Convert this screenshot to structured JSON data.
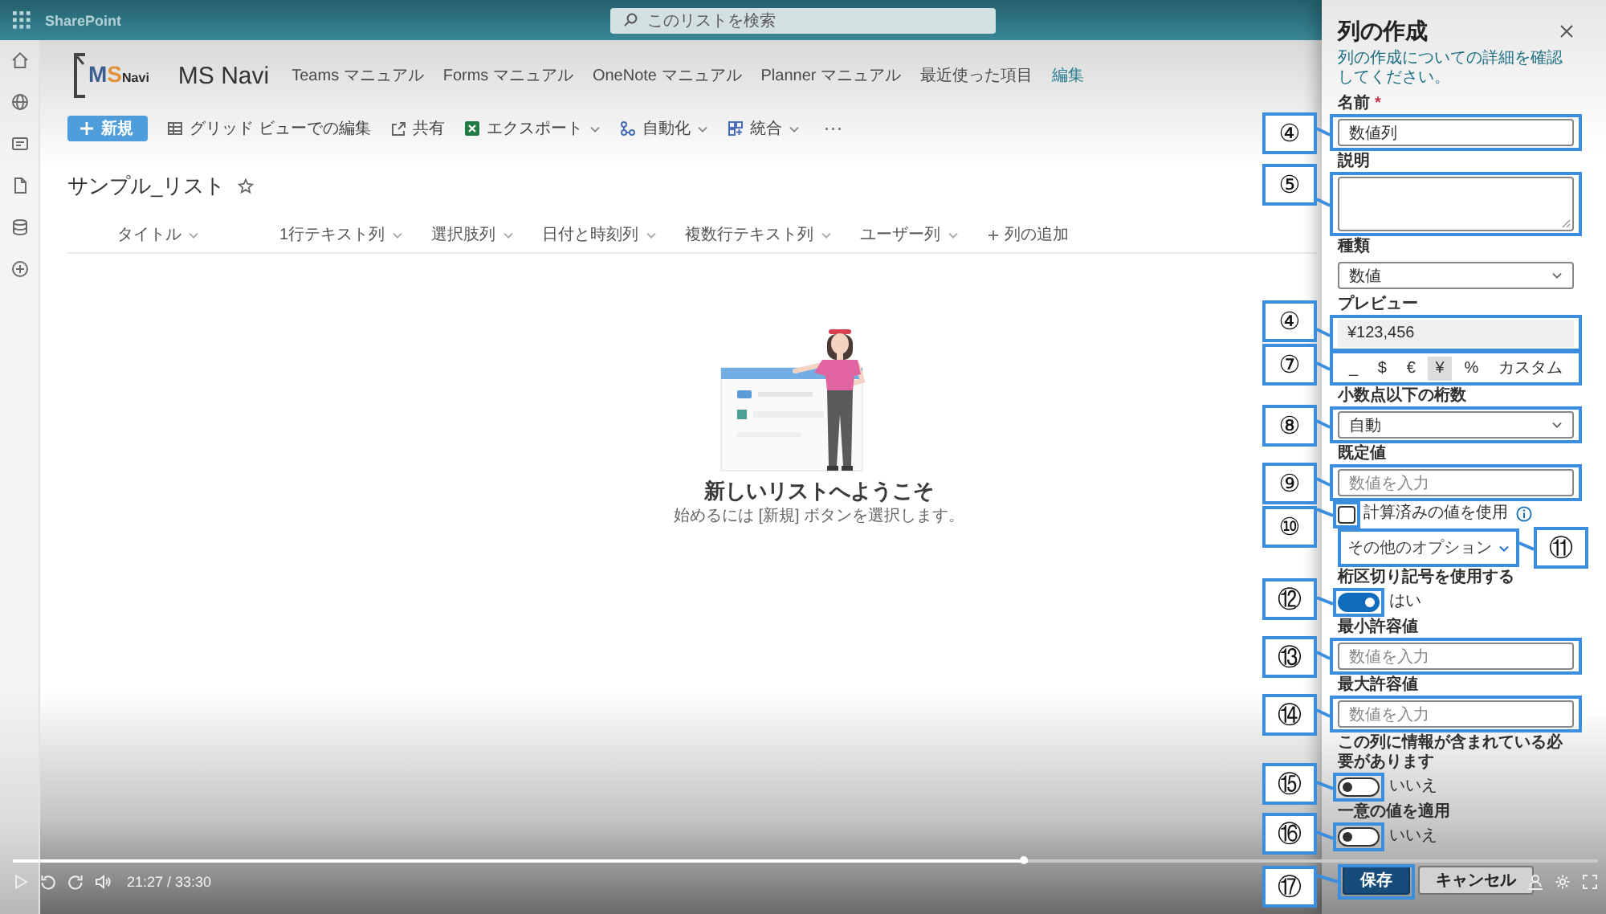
{
  "top_bar": {
    "app_name": "SharePoint",
    "search": {
      "placeholder": "このリストを検索"
    }
  },
  "site_header": {
    "logo": {
      "parts": [
        {
          "text": "M",
          "kind": "initial",
          "color": "#3c5f8f"
        },
        {
          "text": "S",
          "kind": "initial",
          "color": "#e0913a"
        },
        {
          "text": "Navi",
          "kind": "word",
          "color": "#2b2b2b"
        }
      ]
    },
    "title": "MS Navi",
    "nav": [
      {
        "label": "Teams マニュアル",
        "kind": "item"
      },
      {
        "label": "Forms マニュアル",
        "kind": "item"
      },
      {
        "label": "OneNote マニュアル",
        "kind": "item"
      },
      {
        "label": "Planner マニュアル",
        "kind": "item"
      },
      {
        "label": "最近使った項目",
        "kind": "item"
      },
      {
        "label": "編集",
        "kind": "link"
      }
    ]
  },
  "command_bar": {
    "items": [
      {
        "label": "新規",
        "kind": "new",
        "dropdown": false
      },
      {
        "label": "グリッド ビューでの編集",
        "kind": "grid",
        "dropdown": false
      },
      {
        "label": "共有",
        "kind": "share",
        "dropdown": false
      },
      {
        "label": "エクスポート",
        "kind": "export",
        "dropdown": true
      },
      {
        "label": "自動化",
        "kind": "automate",
        "dropdown": true
      },
      {
        "label": "統合",
        "kind": "integrate",
        "dropdown": true
      },
      {
        "label": "⋯",
        "kind": "more",
        "dropdown": false
      }
    ]
  },
  "list": {
    "title": "サンプル_リスト",
    "favorite": false,
    "columns": [
      {
        "label": "タイトル",
        "kind": "column"
      },
      {
        "label": "1行テキスト列",
        "kind": "column"
      },
      {
        "label": "選択肢列",
        "kind": "column"
      },
      {
        "label": "日付と時刻列",
        "kind": "column"
      },
      {
        "label": "複数行テキスト列",
        "kind": "column"
      },
      {
        "label": "ユーザー列",
        "kind": "column"
      },
      {
        "label": "列の追加",
        "kind": "add"
      }
    ]
  },
  "empty_state": {
    "heading": "新しいリストへようこそ",
    "text": "始めるには [新規] ボタンを選択します。"
  },
  "panel": {
    "title": "列の作成",
    "link": "列の作成についての詳細を確認してください。",
    "fields": [
      {
        "kind": "text",
        "label": "名前",
        "required_mark": "*",
        "value": "数値列",
        "callout": "④"
      },
      {
        "kind": "textarea",
        "label": "説明",
        "callout": "⑤"
      },
      {
        "kind": "dropdown",
        "label": "種類",
        "value": "数値"
      },
      {
        "kind": "preview",
        "label": "プレビュー",
        "value": "¥123,456",
        "callout": "④"
      },
      {
        "kind": "options",
        "options": [
          {
            "label": "_",
            "selected": false
          },
          {
            "label": "$",
            "selected": false
          },
          {
            "label": "€",
            "selected": false
          },
          {
            "label": "¥",
            "selected": true
          },
          {
            "label": "%",
            "selected": false
          },
          {
            "label": "カスタム",
            "selected": false
          }
        ],
        "callout": "⑦"
      },
      {
        "kind": "dropdown",
        "label": "小数点以下の桁数",
        "value": "自動",
        "callout": "⑧"
      },
      {
        "kind": "text",
        "label": "既定値",
        "placeholder": "数値を入力",
        "callout": "⑨"
      },
      {
        "kind": "checkbox",
        "label": "計算済みの値を使用",
        "checked": false,
        "callout": "⑩"
      },
      {
        "kind": "more",
        "label": "その他のオプション",
        "callout": "⑪"
      },
      {
        "kind": "toggle",
        "label": "桁区切り記号を使用する",
        "on": true,
        "state_text": "はい",
        "callout": "⑫"
      },
      {
        "kind": "text",
        "label": "最小許容値",
        "placeholder": "数値を入力",
        "callout": "⑬"
      },
      {
        "kind": "text",
        "label": "最大許容値",
        "placeholder": "数値を入力",
        "callout": "⑭"
      },
      {
        "kind": "toggle",
        "label": "この列に情報が含まれている必要があります",
        "on": false,
        "state_text": "いいえ",
        "callout": "⑮"
      },
      {
        "kind": "toggle",
        "label": "一意の値を適用",
        "on": false,
        "state_text": "いいえ",
        "callout": "⑯"
      }
    ],
    "buttons": [
      {
        "label": "保存",
        "kind": "primary",
        "callout": "⑰"
      },
      {
        "label": "キャンセル",
        "kind": "secondary"
      }
    ]
  },
  "video_player": {
    "progress": {
      "level": 0.64
    },
    "time": "21:27 / 33:30"
  }
}
